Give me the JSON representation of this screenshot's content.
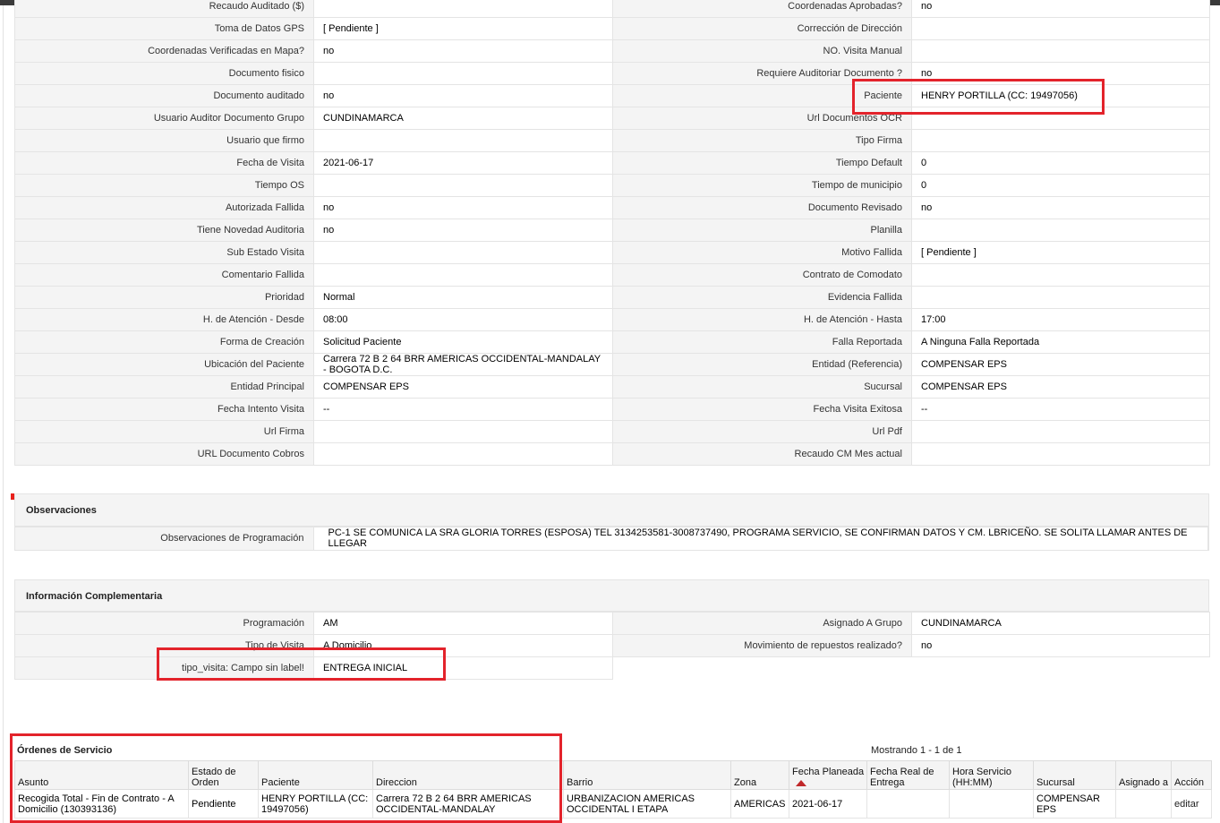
{
  "detail_rows": [
    {
      "l1": "Recaudo Auditado ($)",
      "v1": "",
      "l2": "Coordenadas Aprobadas?",
      "v2": "no"
    },
    {
      "l1": "Toma de Datos GPS",
      "v1": "[ Pendiente ]",
      "l2": "Corrección de Dirección",
      "v2": ""
    },
    {
      "l1": "Coordenadas Verificadas en Mapa?",
      "v1": "no",
      "l2": "NO. Visita Manual",
      "v2": ""
    },
    {
      "l1": "Documento fisico",
      "v1": "",
      "l2": "Requiere Auditoriar Documento ?",
      "v2": "no"
    },
    {
      "l1": "Documento auditado",
      "v1": "no",
      "l2": "Paciente",
      "v2": "HENRY PORTILLA (CC: 19497056)"
    },
    {
      "l1": "Usuario Auditor Documento Grupo",
      "v1": "CUNDINAMARCA",
      "l2": "Url Documentos OCR",
      "v2": ""
    },
    {
      "l1": "Usuario que firmo",
      "v1": "",
      "l2": "Tipo Firma",
      "v2": ""
    },
    {
      "l1": "Fecha de Visita",
      "v1": "2021-06-17",
      "l2": "Tiempo Default",
      "v2": "0"
    },
    {
      "l1": "Tiempo OS",
      "v1": "",
      "l2": "Tiempo de municipio",
      "v2": "0"
    },
    {
      "l1": "Autorizada Fallida",
      "v1": "no",
      "l2": "Documento Revisado",
      "v2": "no"
    },
    {
      "l1": "Tiene Novedad Auditoria",
      "v1": "no",
      "l2": "Planilla",
      "v2": ""
    },
    {
      "l1": "Sub Estado Visita",
      "v1": "",
      "l2": "Motivo Fallida",
      "v2": "[ Pendiente ]"
    },
    {
      "l1": "Comentario Fallida",
      "v1": "",
      "l2": "Contrato de Comodato",
      "v2": ""
    },
    {
      "l1": "Prioridad",
      "v1": "Normal",
      "l2": "Evidencia Fallida",
      "v2": ""
    },
    {
      "l1": "H. de Atención - Desde",
      "v1": "08:00",
      "l2": "H. de Atención - Hasta",
      "v2": "17:00"
    },
    {
      "l1": "Forma de Creación",
      "v1": "Solicitud Paciente",
      "l2": "Falla Reportada",
      "v2": "A Ninguna Falla Reportada"
    },
    {
      "l1": "Ubicación del Paciente",
      "v1": "Carrera 72 B 2 64 BRR AMERICAS OCCIDENTAL-MANDALAY - BOGOTA D.C.",
      "l2": "Entidad (Referencia)",
      "v2": "COMPENSAR EPS"
    },
    {
      "l1": "Entidad Principal",
      "v1": "COMPENSAR EPS",
      "l2": "Sucursal",
      "v2": "COMPENSAR EPS"
    },
    {
      "l1": "Fecha Intento Visita",
      "v1": "--",
      "l2": "Fecha Visita Exitosa",
      "v2": "--"
    },
    {
      "l1": "Url Firma",
      "v1": "",
      "l2": "Url Pdf",
      "v2": ""
    },
    {
      "l1": "URL Documento Cobros",
      "v1": "",
      "l2": "Recaudo CM Mes actual",
      "v2": ""
    }
  ],
  "observaciones": {
    "title": "Observaciones",
    "label": "Observaciones de Programación",
    "value": "PC-1 SE COMUNICA LA SRA GLORIA TORRES (ESPOSA) TEL 3134253581-3008737490, PROGRAMA SERVICIO, SE CONFIRMAN DATOS Y CM. LBRICEÑO. SE SOLITA LLAMAR ANTES DE LLEGAR"
  },
  "info": {
    "title": "Información Complementaria",
    "rows": [
      {
        "l1": "Programación",
        "v1": "AM",
        "l2": "Asignado A Grupo",
        "v2": "CUNDINAMARCA"
      },
      {
        "l1": "Tipo de Visita",
        "v1": "A Domicilio",
        "l2": "Movimiento de repuestos realizado?",
        "v2": "no"
      },
      {
        "l1": "tipo_visita: Campo sin label!",
        "v1": "ENTREGA INICIAL"
      }
    ]
  },
  "ordenes": {
    "title": "Órdenes de Servicio",
    "count": "Mostrando 1 - 1 de 1",
    "headers": [
      "Asunto",
      "Estado de Orden",
      "Paciente",
      "Direccion",
      "Barrio",
      "Zona",
      "Fecha Planeada",
      "Fecha Real de Entrega",
      "Hora Servicio (HH:MM)",
      "Sucursal",
      "Asignado a",
      "Acción"
    ],
    "rows": [
      [
        "Recogida Total - Fin de Contrato - A Domicilio (130393136)",
        "Pendiente",
        "HENRY PORTILLA (CC: 19497056)",
        "Carrera 72 B 2 64 BRR AMERICAS OCCIDENTAL-MANDALAY",
        "URBANIZACION AMERICAS OCCIDENTAL I ETAPA",
        "AMERICAS",
        "2021-06-17",
        "",
        "",
        "COMPENSAR EPS",
        "",
        "editar"
      ]
    ]
  },
  "colors": {
    "highlight": "#e3232b",
    "label_bg": "#f4f4f4",
    "border": "#e4e4e4"
  }
}
